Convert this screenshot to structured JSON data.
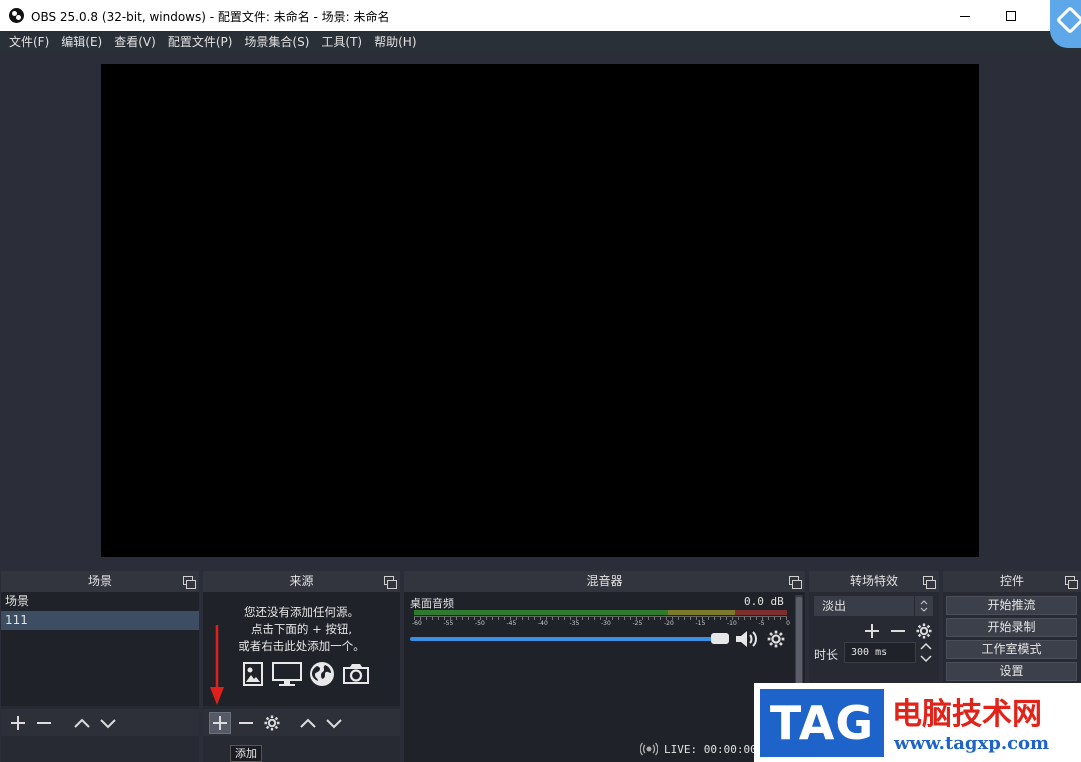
{
  "window": {
    "title": "OBS 25.0.8 (32-bit, windows) - 配置文件: 未命名 - 场景: 未命名"
  },
  "menu": [
    "文件(F)",
    "编辑(E)",
    "查看(V)",
    "配置文件(P)",
    "场景集合(S)",
    "工具(T)",
    "帮助(H)"
  ],
  "scenes": {
    "title": "场景",
    "items": [
      "场景",
      "111"
    ],
    "selected_index": 1
  },
  "sources": {
    "title": "来源",
    "empty_line1": "您还没有添加任何源。",
    "empty_line2": "点击下面的 + 按钮,",
    "empty_line3": "或者右击此处添加一个。"
  },
  "mixer": {
    "title": "混音器",
    "track_name": "桌面音频",
    "db_value": "0.0 dB",
    "meter_labels": [
      "-60",
      "-55",
      "-50",
      "-45",
      "-40",
      "-35",
      "-30",
      "-25",
      "-20",
      "-15",
      "-10",
      "-5",
      "0"
    ],
    "volume_fraction": 1.0
  },
  "transitions": {
    "title": "转场特效",
    "selected": "淡出",
    "duration_label": "时长",
    "duration_value": "300 ms"
  },
  "controls": {
    "title": "控件",
    "buttons": [
      "开始推流",
      "开始录制",
      "工作室模式",
      "设置"
    ]
  },
  "status": {
    "live": "LIVE: 00:00:00"
  },
  "tooltip": "添加",
  "watermark": {
    "tag": "TAG",
    "name": "电脑技术网",
    "url": "www.tagxp.com"
  },
  "colors": {
    "accent": "#3a8ee6",
    "arrow": "#e0201b"
  }
}
